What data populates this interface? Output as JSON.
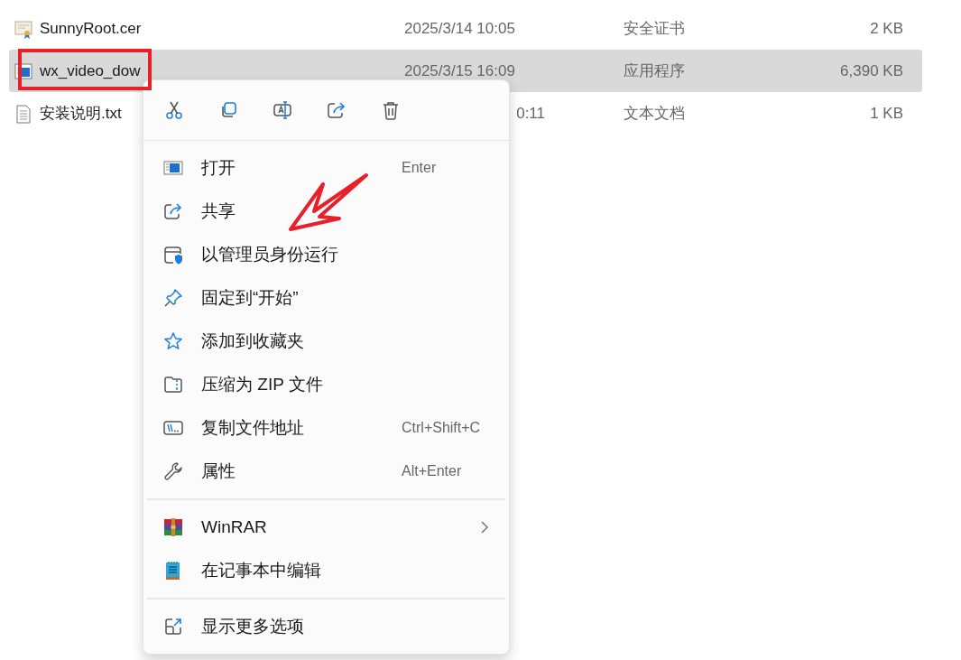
{
  "files": [
    {
      "kind": "certificate",
      "name": "SunnyRoot.cer",
      "date": "2025/3/14 10:05",
      "type": "安全证书",
      "size": "2 KB",
      "selected": false
    },
    {
      "kind": "application",
      "name": "wx_video_dow",
      "date": "2025/3/15 16:09",
      "type": "应用程序",
      "size": "6,390 KB",
      "selected": true
    },
    {
      "kind": "text",
      "name": "安装说明.txt",
      "date": "0:11",
      "type": "文本文档",
      "size": "1 KB",
      "selected": false
    }
  ],
  "context_menu": {
    "toolbar": [
      {
        "kind": "cut"
      },
      {
        "kind": "copy"
      },
      {
        "kind": "rename"
      },
      {
        "kind": "share"
      },
      {
        "kind": "delete"
      }
    ],
    "groups": [
      [
        {
          "kind": "open",
          "label": "打开",
          "shortcut": "Enter",
          "has_submenu": false
        },
        {
          "kind": "share",
          "label": "共享",
          "has_submenu": false
        },
        {
          "kind": "admin",
          "label": "以管理员身份运行",
          "has_submenu": false
        },
        {
          "kind": "pin",
          "label": "固定到“开始”",
          "has_submenu": false
        },
        {
          "kind": "star",
          "label": "添加到收藏夹",
          "has_submenu": false
        },
        {
          "kind": "zip",
          "label": "压缩为 ZIP 文件",
          "has_submenu": false
        },
        {
          "kind": "path",
          "label": "复制文件地址",
          "shortcut": "Ctrl+Shift+C",
          "has_submenu": false
        },
        {
          "kind": "wrench",
          "label": "属性",
          "shortcut": "Alt+Enter",
          "has_submenu": false
        }
      ],
      [
        {
          "kind": "winrar",
          "label": "WinRAR",
          "has_submenu": true
        },
        {
          "kind": "notepad",
          "label": "在记事本中编辑",
          "has_submenu": false
        }
      ],
      [
        {
          "kind": "more",
          "label": "显示更多选项",
          "has_submenu": false
        }
      ]
    ]
  }
}
